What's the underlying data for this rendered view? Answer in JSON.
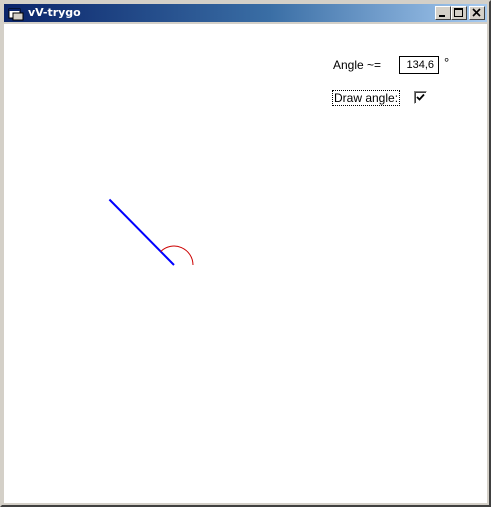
{
  "window": {
    "title": "vV-trygo"
  },
  "controls": {
    "angle_label": "Angle ~=",
    "angle_value": "134,6",
    "degree_symbol": "°",
    "draw_angle_label": "Draw angle:",
    "draw_angle_checked": true
  },
  "drawing": {
    "angle_degrees": 134.6,
    "line_color": "#0000ff",
    "arc_color": "#cc0000"
  }
}
